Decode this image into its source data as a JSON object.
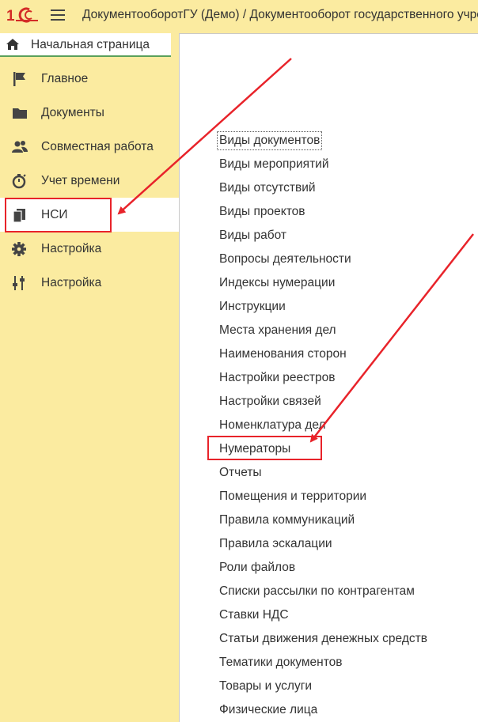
{
  "header": {
    "app_title": "ДокументооборотГУ (Демо) / Документооборот государственного учреждения"
  },
  "home_tab": {
    "label": "Начальная страница"
  },
  "sidebar": {
    "items": [
      {
        "label": "Главное",
        "icon": "flag-icon"
      },
      {
        "label": "Документы",
        "icon": "folder-icon"
      },
      {
        "label": "Совместная работа",
        "icon": "users-icon"
      },
      {
        "label": "Учет времени",
        "icon": "stopwatch-icon"
      },
      {
        "label": "НСИ",
        "icon": "books-icon",
        "active": true
      },
      {
        "label": "Настройка",
        "icon": "gear-icon"
      },
      {
        "label": "Настройка",
        "icon": "sliders-icon"
      }
    ]
  },
  "content": {
    "items": [
      "Виды документов",
      "Виды мероприятий",
      "Виды отсутствий",
      "Виды проектов",
      "Виды работ",
      "Вопросы деятельности",
      "Индексы нумерации",
      "Инструкции",
      "Места хранения дел",
      "Наименования сторон",
      "Настройки реестров",
      "Настройки связей",
      "Номенклатура дел",
      "Нумераторы",
      "Отчеты",
      "Помещения и территории",
      "Правила коммуникаций",
      "Правила эскалации",
      "Роли файлов",
      "Списки рассылки по контрагентам",
      "Ставки НДС",
      "Статьи движения денежных средств",
      "Тематики документов",
      "Товары и услуги",
      "Физические лица"
    ]
  },
  "colors": {
    "sidebar_bg": "#fbeba0",
    "highlight_red": "#e8232a",
    "tab_underline": "#5aa05a",
    "text": "#333333"
  }
}
